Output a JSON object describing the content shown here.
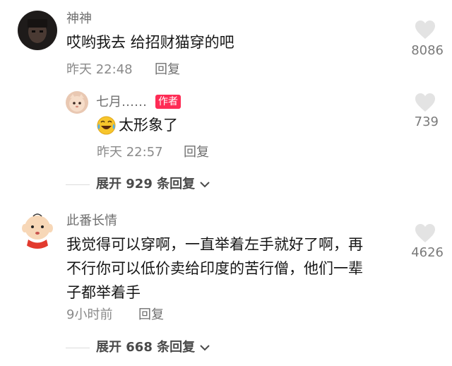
{
  "comments": [
    {
      "username": "神神",
      "text": "哎哟我去 给招财猫穿的吧",
      "time": "昨天 22:48",
      "reply_label": "回复",
      "likes": "8086",
      "replies": [
        {
          "username": "七月……",
          "badge": "作者",
          "emoji_name": "laughing-crying-emoji",
          "text": "太形象了",
          "time": "昨天 22:57",
          "reply_label": "回复",
          "likes": "739"
        }
      ],
      "expand_label": "展开 929 条回复"
    },
    {
      "username": "此番长情",
      "text_lines": [
        "我觉得可以穿啊，一直举着左手就好了啊，再",
        "不行你可以低价卖给印度的苦行僧，他们一辈",
        "子都举着手"
      ],
      "time": "9小时前",
      "reply_label": "回复",
      "likes": "4626",
      "expand_label": "展开 668 条回复"
    }
  ],
  "colors": {
    "badge": "#fe2c55",
    "heart": "#e3e3e3"
  }
}
